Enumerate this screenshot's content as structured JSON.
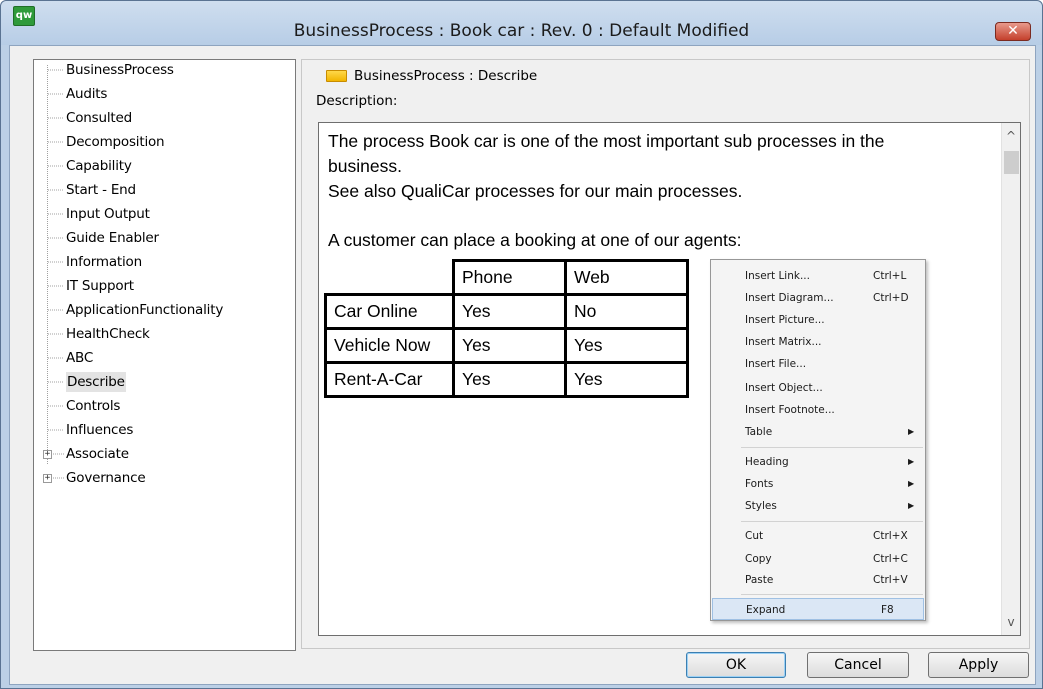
{
  "window": {
    "title": "BusinessProcess : Book car : Rev. 0 : Default Modified",
    "app_icon_text": "qw",
    "close_symbol": "✕"
  },
  "tree": {
    "items": [
      {
        "label": "BusinessProcess"
      },
      {
        "label": "Audits"
      },
      {
        "label": "Consulted"
      },
      {
        "label": "Decomposition"
      },
      {
        "label": "Capability"
      },
      {
        "label": "Start - End"
      },
      {
        "label": "Input Output"
      },
      {
        "label": "Guide Enabler"
      },
      {
        "label": "Information"
      },
      {
        "label": "IT Support"
      },
      {
        "label": "ApplicationFunctionality"
      },
      {
        "label": "HealthCheck"
      },
      {
        "label": "ABC"
      },
      {
        "label": "Describe"
      },
      {
        "label": "Controls"
      },
      {
        "label": "Influences"
      },
      {
        "label": "Associate"
      },
      {
        "label": "Governance"
      }
    ],
    "selected": "Describe",
    "expander_symbol": "+"
  },
  "panel": {
    "header": "BusinessProcess : Describe",
    "description_label": "Description:"
  },
  "editor": {
    "lines": [
      "The process Book car is one of the most important sub processes in the",
      "business.",
      "See also QualiCar processes for our main processes.",
      "A customer can place a booking at one of our agents:"
    ],
    "table": {
      "columns": [
        "Phone",
        "Web"
      ],
      "rows": [
        {
          "agent": "Car Online",
          "phone": "Yes",
          "web": "No"
        },
        {
          "agent": "Vehicle Now",
          "phone": "Yes",
          "web": "Yes"
        },
        {
          "agent": "Rent-A-Car",
          "phone": "Yes",
          "web": "Yes"
        }
      ]
    },
    "scroll_up": "^",
    "scroll_down": "v"
  },
  "context_menu": {
    "insert_link": {
      "label": "Insert Link...",
      "shortcut": "Ctrl+L"
    },
    "insert_diagram": {
      "label": "Insert Diagram...",
      "shortcut": "Ctrl+D"
    },
    "insert_picture": {
      "label": "Insert Picture..."
    },
    "insert_matrix": {
      "label": "Insert Matrix..."
    },
    "insert_file": {
      "label": "Insert File..."
    },
    "insert_object": {
      "label": "Insert Object..."
    },
    "insert_footnote": {
      "label": "Insert Footnote..."
    },
    "table": {
      "label": "Table"
    },
    "heading": {
      "label": "Heading"
    },
    "fonts": {
      "label": "Fonts"
    },
    "styles": {
      "label": "Styles"
    },
    "cut": {
      "label": "Cut",
      "shortcut": "Ctrl+X"
    },
    "copy": {
      "label": "Copy",
      "shortcut": "Ctrl+C"
    },
    "paste": {
      "label": "Paste",
      "shortcut": "Ctrl+V"
    },
    "expand": {
      "label": "Expand",
      "shortcut": "F8"
    },
    "submenu_arrow": "▶",
    "highlighted": "Expand"
  },
  "buttons": {
    "ok": "OK",
    "cancel": "Cancel",
    "apply": "Apply"
  },
  "colors": {
    "titlebar": "#bcd0e6",
    "close_button": "#c4402c",
    "folder_icon": "#f2b500",
    "menu_highlight": "#dbe7f5"
  }
}
